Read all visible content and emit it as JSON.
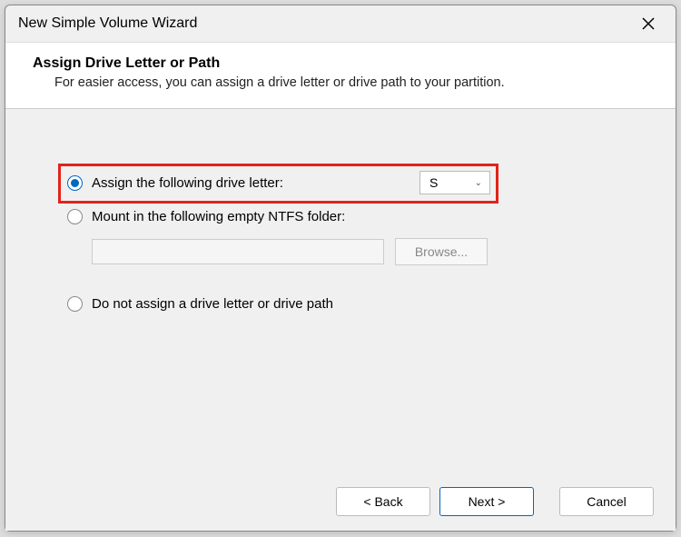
{
  "titlebar": {
    "title": "New Simple Volume Wizard"
  },
  "header": {
    "title": "Assign Drive Letter or Path",
    "subtitle": "For easier access, you can assign a drive letter or drive path to your partition."
  },
  "options": {
    "assign_letter": {
      "label": "Assign the following drive letter:",
      "selected_letter": "S"
    },
    "mount_folder": {
      "label": "Mount in the following empty NTFS folder:",
      "path": "",
      "browse_label": "Browse..."
    },
    "no_assign": {
      "label": "Do not assign a drive letter or drive path"
    }
  },
  "footer": {
    "back": "< Back",
    "next": "Next >",
    "cancel": "Cancel"
  }
}
